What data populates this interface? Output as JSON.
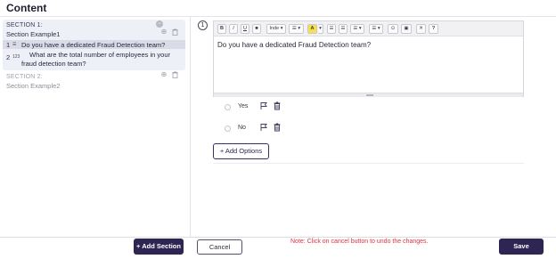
{
  "header": {
    "title": "Content"
  },
  "sidebar": {
    "sections": [
      {
        "label": "SECTION 1:",
        "name": "Section Example1",
        "questions": [
          {
            "number": "1",
            "type": "☰",
            "text": "Do you have a dedicated Fraud Detection team?"
          },
          {
            "number": "2",
            "type": "123",
            "text": "What are the total number of employees in your fraud detection team?"
          }
        ]
      },
      {
        "label": "SECTION 2:",
        "name": "Section Example2",
        "questions": []
      }
    ],
    "add_section_label": "+ Add Section"
  },
  "editor": {
    "question_number": "1",
    "toolbar": {
      "bold": "B",
      "italic": "I",
      "underline": "U",
      "strike": "■",
      "indent": "Inde ▾",
      "list": "☰ ▾",
      "font_color": "A",
      "font_color_arrow": "▾",
      "ordered_list": "☰",
      "unordered_list": "☰",
      "align": "☰ ▾",
      "line_height": "☰ ▾",
      "link": "⊙",
      "image": "▣",
      "clear": "✕",
      "help": "?"
    },
    "content": "Do you have a dedicated Fraud Detection team?"
  },
  "options": [
    {
      "label": "Yes"
    },
    {
      "label": "No"
    }
  ],
  "add_options_label": "+ Add Options",
  "footer": {
    "cancel_label": "Cancel",
    "note": "Note: Click on cancel button to undo the changes.",
    "save_label": "Save"
  },
  "colors": {
    "primary": "#2f2552",
    "note": "#e0323f",
    "selected_row": "#dadbe6",
    "section_bg": "#eef0f7"
  }
}
